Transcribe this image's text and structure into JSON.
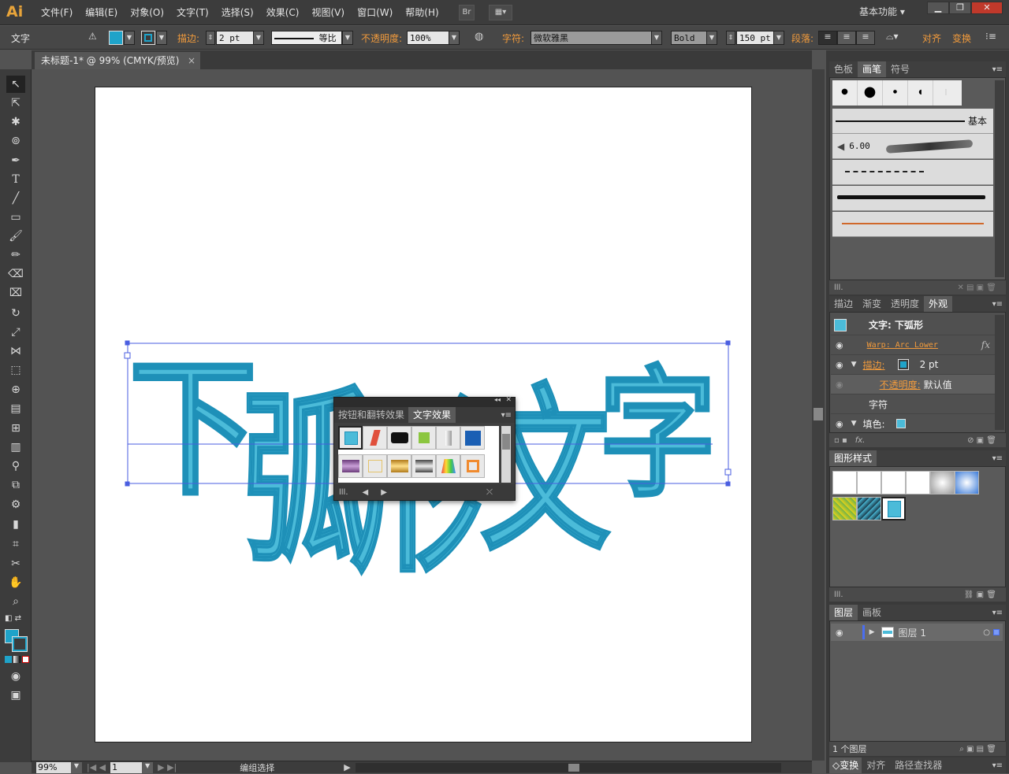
{
  "app": {
    "logo": "Ai"
  },
  "menu": [
    "文件(F)",
    "编辑(E)",
    "对象(O)",
    "文字(T)",
    "选择(S)",
    "效果(C)",
    "视图(V)",
    "窗口(W)",
    "帮助(H)"
  ],
  "menubar": {
    "bridge_label": "Br",
    "workspace": "基本功能",
    "workspace_caret": "▾"
  },
  "window_controls": {
    "minimize": "▁",
    "restore": "❐",
    "close": "✕"
  },
  "controlbar": {
    "tool_name": "文字",
    "stroke_label": "描边:",
    "stroke_value": "2 pt",
    "profile_label": "等比",
    "opacity_label": "不透明度:",
    "opacity_value": "100%",
    "font_label": "字符:",
    "font_value": "微软雅黑",
    "style_value": "Bold",
    "size_value": "150 pt",
    "paragraph_label": "段落:",
    "align_label": "对齐",
    "transform_label": "变换"
  },
  "document": {
    "tab_title": "未标题-1* @ 99% (CMYK/预览)",
    "close": "×"
  },
  "canvas": {
    "text": [
      "下",
      "弧",
      "形",
      "文",
      "字"
    ],
    "fill_color": "#4bbbd9",
    "stroke_color": "#1e90b8",
    "shadow_color": "#a6dde9",
    "selection_color": "#4a5ee0"
  },
  "float_panel": {
    "tabs": [
      "按钮和翻转效果",
      "文字效果"
    ],
    "active_tab": 1,
    "collapse_icon": "◂◂",
    "close_icon": "✕"
  },
  "status": {
    "zoom": "99%",
    "artboard": "1",
    "status_text": "编组选择"
  },
  "panels": {
    "swatch_tabs": [
      "色板",
      "画笔",
      "符号"
    ],
    "brush_active": 1,
    "brush_basic": "基本",
    "brush_size": "6.00",
    "appearance_tabs": [
      "描边",
      "渐变",
      "透明度",
      "外观"
    ],
    "appearance_active": 3,
    "appearance": {
      "title": "文字: 下弧形",
      "warp": "Warp: Arc Lower",
      "stroke_label": "描边:",
      "stroke_value": "2 pt",
      "opacity_label": "不透明度:",
      "opacity_value": "默认值",
      "char_label": "字符",
      "fill_label": "填色:"
    },
    "graphic_styles_tab": "图形样式",
    "layer_tabs": [
      "图层",
      "画板"
    ],
    "layer_name": "图层 1",
    "layer_count": "1 个图层",
    "bottom_tabs": [
      "变换",
      "对齐",
      "路径查找器"
    ]
  },
  "colors": {
    "accent": "#1fa3c9",
    "orange": "#f29b3c"
  }
}
